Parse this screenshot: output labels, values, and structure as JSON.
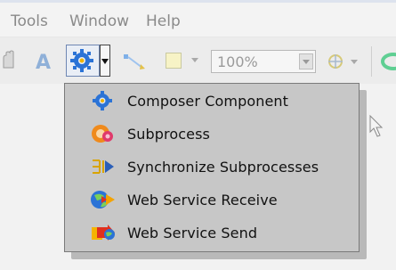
{
  "menubar": {
    "items": [
      "Tools",
      "Window",
      "Help"
    ]
  },
  "toolbar": {
    "zoom_value": "100%",
    "icons": [
      "hand-icon",
      "text-tool-icon",
      "composer-gear-icon",
      "dropdown-arrow-icon",
      "connector-icon",
      "fill-color-icon",
      "grid-icon"
    ]
  },
  "popup_menu": {
    "items": [
      {
        "label": "Composer Component",
        "icon": "composer-component-icon"
      },
      {
        "label": "Subprocess",
        "icon": "subprocess-icon"
      },
      {
        "label": "Synchronize Subprocesses",
        "icon": "synchronize-subprocesses-icon"
      },
      {
        "label": "Web Service Receive",
        "icon": "web-service-receive-icon"
      },
      {
        "label": "Web Service Send",
        "icon": "web-service-send-icon"
      }
    ]
  },
  "colors": {
    "menu_bg": "#c7c7c7",
    "menubar_text": "#8a8a8a",
    "accent_blue": "#2b73d6"
  }
}
